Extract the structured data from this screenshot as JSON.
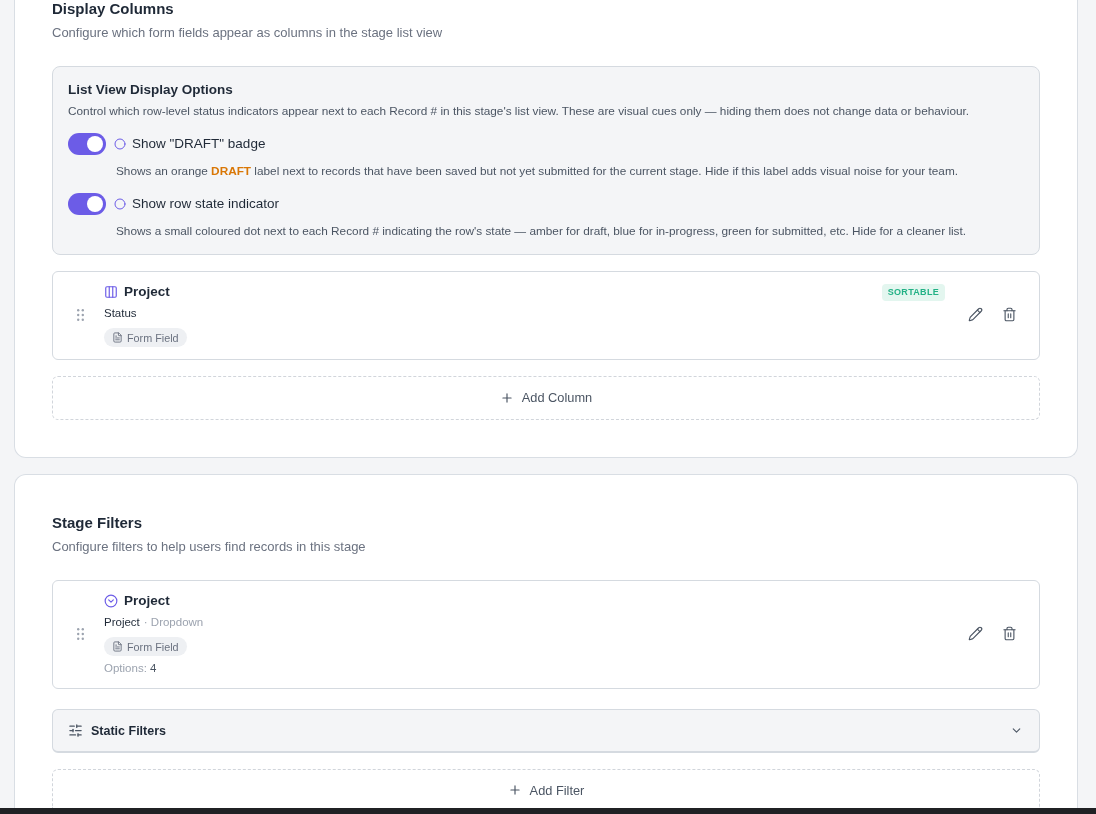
{
  "display_columns": {
    "title": "Display Columns",
    "subtitle": "Configure which form fields appear as columns in the stage list view",
    "display_options": {
      "title": "List View Display Options",
      "description": "Control which row-level status indicators appear next to each Record # in this stage's list view. These are visual cues only — hiding them does not change data or behaviour.",
      "options": [
        {
          "label": "Show \"DRAFT\" badge",
          "on": true,
          "description": "Shows an orange **DRAFT** label next to records that have been saved but not yet submitted for the current stage. Hide if this label adds visual noise for your team."
        },
        {
          "label": "Show row state indicator",
          "on": true,
          "description": "Shows a small coloured dot next to each Record # indicating the row's state — amber for draft, blue for in-progress, green for submitted, etc. Hide for a cleaner list."
        }
      ]
    },
    "columns": [
      {
        "title": "Project",
        "field": "Status",
        "source": "Form Field",
        "badge": "SORTABLE"
      }
    ],
    "add_button": "Add Column"
  },
  "stage_filters": {
    "title": "Stage Filters",
    "subtitle": "Configure filters to help users find records in this stage",
    "filters": [
      {
        "title": "Project",
        "field": "Project",
        "type": "· Dropdown",
        "source": "Form Field",
        "options": "Options: **4**"
      }
    ],
    "static_filters": {
      "label": "Static Filters",
      "expanded": false
    },
    "add_button": "Add Filter"
  }
}
